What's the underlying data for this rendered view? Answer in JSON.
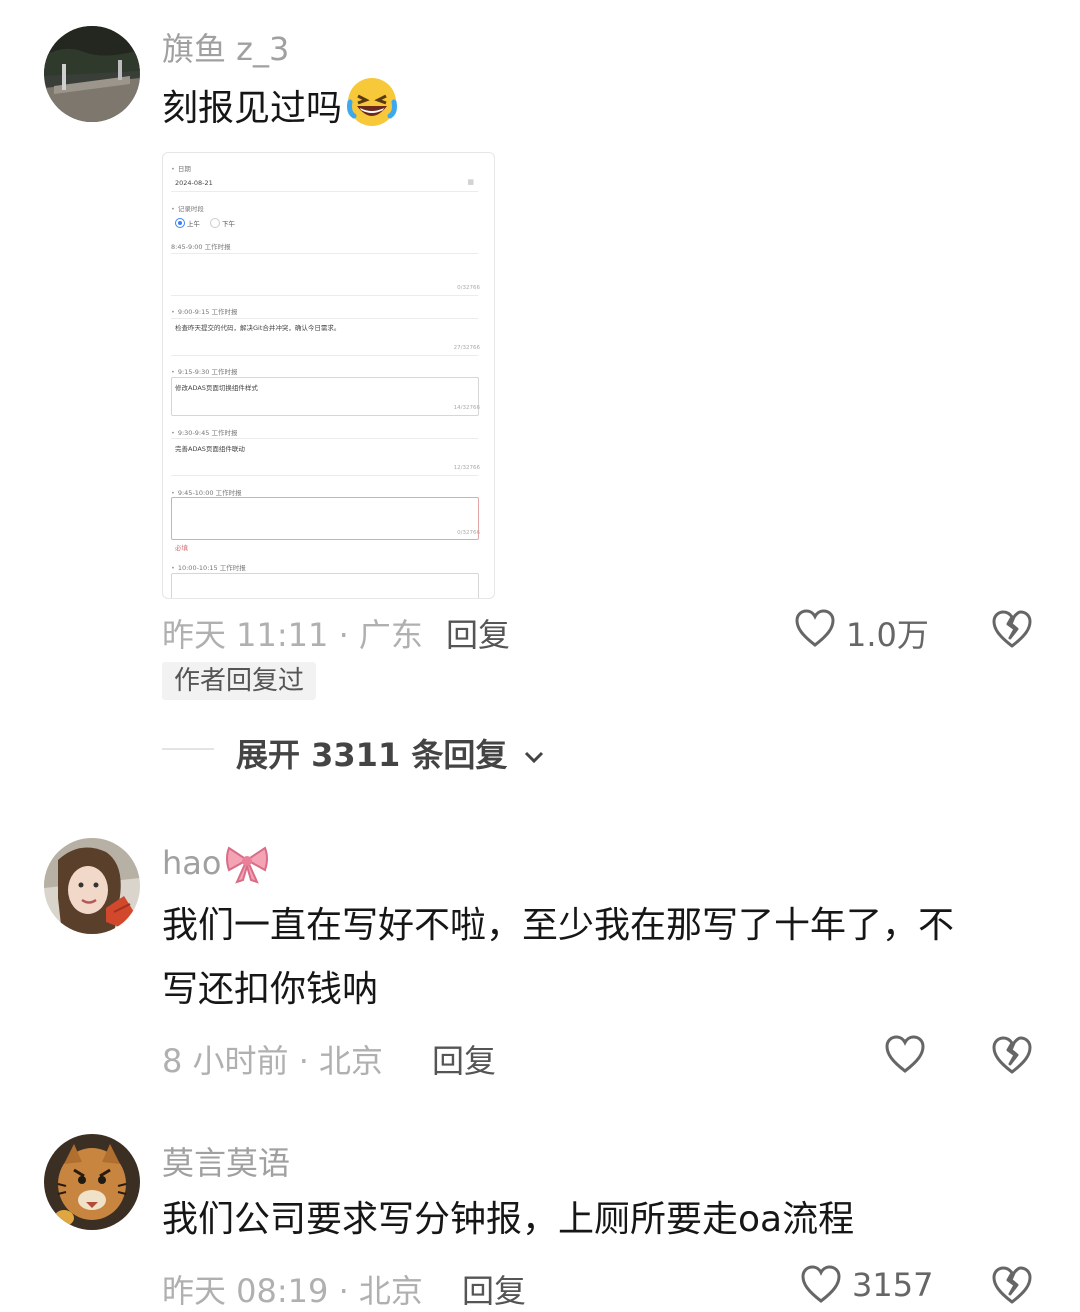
{
  "comments": [
    {
      "username": "旗鱼 z_3",
      "text": "刻报见过吗",
      "emoji": "grinning-squinting-face-emoji",
      "time_location": "昨天 11:11 · 广东",
      "reply_label": "回复",
      "likes": "1.0万",
      "author_badge": "作者回复过",
      "expand_label": "展开 3311 条回复"
    },
    {
      "username": "hao",
      "name_icon": "pink-bow-icon",
      "text_line1": "我们一直在写好不啦，至少我在那写了十年了，不",
      "text_line2": "写还扣你钱呐",
      "time_location": "8 小时前 · 北京",
      "reply_label": "回复",
      "likes": ""
    },
    {
      "username": "莫言莫语",
      "text": "我们公司要求写分钟报，上厕所要走oa流程",
      "time_location": "昨天 08:19 · 北京",
      "reply_label": "回复",
      "likes": "3157"
    }
  ],
  "form": {
    "date_label": "日期",
    "date_value": "2024-08-21",
    "time_label": "记录时段",
    "am_label": "上午",
    "pm_label": "下午",
    "fields": [
      {
        "label": "8:45-9:00 工作时报",
        "value": "",
        "count": "0/32766"
      },
      {
        "label": "9:00-9:15 工作时报",
        "value": "检查昨天提交的代码，解决Git合并冲突，确认今日需求。",
        "count": "27/32766"
      },
      {
        "label": "9:15-9:30 工作时报",
        "value": "修改ADAS页面切换组件样式",
        "count": "14/32766"
      },
      {
        "label": "9:30-9:45 工作时报",
        "value": "完善ADAS页面组件联动",
        "count": "12/32766"
      },
      {
        "label": "9:45-10:00 工作时报",
        "value": "",
        "count": "0/32766"
      },
      {
        "label": "10:00-10:15 工作时报",
        "value": "",
        "count": ""
      }
    ],
    "required_hint": "必填"
  },
  "colors": {
    "username": "#a0a0a0",
    "body_text": "#161616",
    "meta": "#b0b0b0",
    "reply": "#555555",
    "badge_bg": "#f2f2f2",
    "radio_selected": "#3b82f6"
  }
}
